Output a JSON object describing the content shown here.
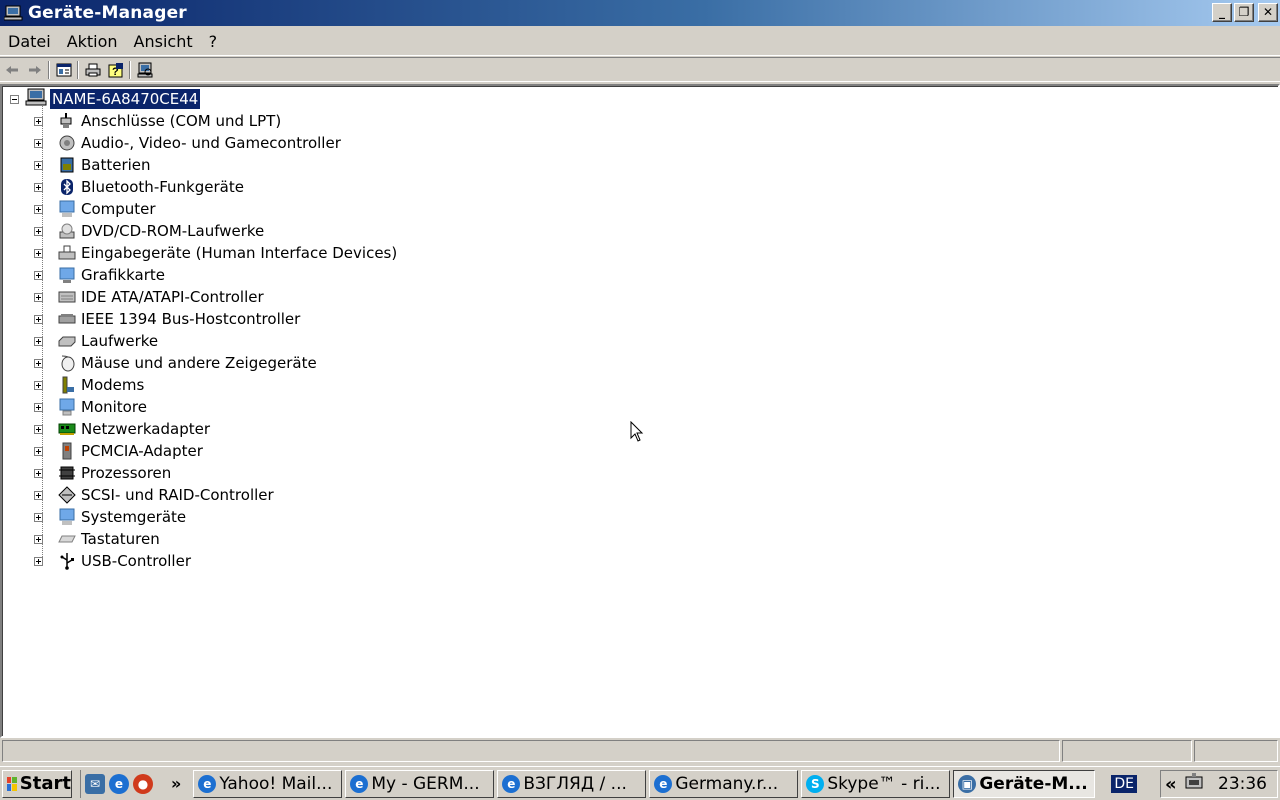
{
  "window": {
    "title": "Geräte-Manager",
    "controls": [
      "_",
      "❐",
      "✕"
    ]
  },
  "menu": {
    "items": [
      "Datei",
      "Aktion",
      "Ansicht",
      "?"
    ]
  },
  "toolbar": {
    "buttons": [
      "back-icon",
      "forward-icon",
      "properties-view-icon",
      "print-icon",
      "help-icon",
      "scan-hardware-icon"
    ]
  },
  "tree": {
    "root": {
      "label": "NAME-6A8470CE44",
      "expanded": true,
      "selected": true
    },
    "children": [
      {
        "label": "Anschlüsse (COM und LPT)",
        "icon": "port-icon"
      },
      {
        "label": "Audio-, Video- und Gamecontroller",
        "icon": "audio-icon"
      },
      {
        "label": "Batterien",
        "icon": "battery-icon"
      },
      {
        "label": "Bluetooth-Funkgeräte",
        "icon": "bluetooth-icon"
      },
      {
        "label": "Computer",
        "icon": "computer-icon"
      },
      {
        "label": "DVD/CD-ROM-Laufwerke",
        "icon": "cdrom-icon"
      },
      {
        "label": "Eingabegeräte (Human Interface Devices)",
        "icon": "hid-icon"
      },
      {
        "label": "Grafikkarte",
        "icon": "display-adapter-icon"
      },
      {
        "label": "IDE ATA/ATAPI-Controller",
        "icon": "ide-icon"
      },
      {
        "label": "IEEE 1394 Bus-Hostcontroller",
        "icon": "firewire-icon"
      },
      {
        "label": "Laufwerke",
        "icon": "disk-drive-icon"
      },
      {
        "label": "Mäuse und andere Zeigegeräte",
        "icon": "mouse-icon"
      },
      {
        "label": "Modems",
        "icon": "modem-icon"
      },
      {
        "label": "Monitore",
        "icon": "monitor-icon"
      },
      {
        "label": "Netzwerkadapter",
        "icon": "network-adapter-icon"
      },
      {
        "label": "PCMCIA-Adapter",
        "icon": "pcmcia-icon"
      },
      {
        "label": "Prozessoren",
        "icon": "processor-icon"
      },
      {
        "label": "SCSI- und RAID-Controller",
        "icon": "scsi-icon"
      },
      {
        "label": "Systemgeräte",
        "icon": "system-device-icon"
      },
      {
        "label": "Tastaturen",
        "icon": "keyboard-icon"
      },
      {
        "label": "USB-Controller",
        "icon": "usb-icon"
      }
    ]
  },
  "taskbar": {
    "start_label": "Start",
    "more_label": "»",
    "tasks": [
      {
        "label": "Yahoo! Mail...",
        "icon": "ie-icon",
        "active": false
      },
      {
        "label": "My - GERM...",
        "icon": "ie-icon",
        "active": false
      },
      {
        "label": "ВЗГЛЯД / ...",
        "icon": "ie-icon",
        "active": false
      },
      {
        "label": "Germany.r...",
        "icon": "ie-icon",
        "active": false
      },
      {
        "label": "Skype™ - ri...",
        "icon": "skype-icon",
        "active": false
      },
      {
        "label": "Geräte-M...",
        "icon": "device-manager-icon",
        "active": true
      }
    ],
    "language": "DE",
    "tray_chevron": "«",
    "clock": "23:36"
  },
  "colors": {
    "selection": "#0a246a",
    "window_face": "#d4d0c8",
    "title_start": "#0a246a",
    "title_end": "#a6caf0"
  }
}
